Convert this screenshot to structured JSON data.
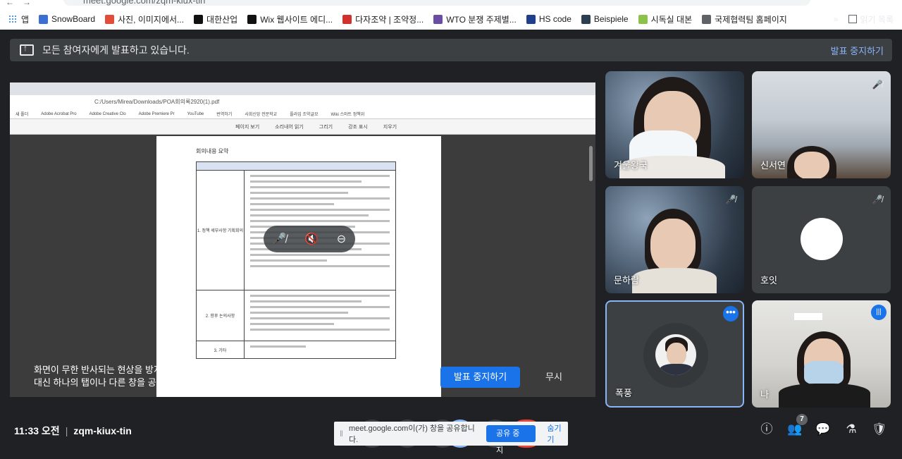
{
  "browser": {
    "url": "meet.google.com/zqm-kiux-tin",
    "bookmarks": [
      {
        "label": "앱",
        "icon": "apps-grid-icon",
        "color": "#1a73e8"
      },
      {
        "label": "SnowBoard",
        "icon": "snowflake-icon",
        "color": "#3b6fd1"
      },
      {
        "label": "사진, 이미지에서...",
        "icon": "image-search-icon",
        "color": "#e34b3b"
      },
      {
        "label": "대한산업",
        "icon": "wix-icon",
        "color": "#111111"
      },
      {
        "label": "Wix 웹사이트 에디...",
        "icon": "wix-icon",
        "color": "#111111"
      },
      {
        "label": "다자조약 | 조약정...",
        "icon": "korea-flag-icon",
        "color": "#d0312d"
      },
      {
        "label": "WTO 분쟁 주제별...",
        "icon": "wto-icon",
        "color": "#6a4ea3"
      },
      {
        "label": "HS code",
        "icon": "shield-icon",
        "color": "#1f3e8c"
      },
      {
        "label": "Beispiele",
        "icon": "dictionary-icon",
        "color": "#2c3e50"
      },
      {
        "label": "시독실 대본",
        "icon": "doc-icon",
        "color": "#8bc34a"
      },
      {
        "label": "국제협력팀 홈페이지",
        "icon": "globe-icon",
        "color": "#5f6368"
      }
    ],
    "overflow": "»",
    "reading_list": "읽기 목록"
  },
  "banner": {
    "message": "모든 참여자에게 발표하고 있습니다.",
    "stop_label": "발표 중지하기"
  },
  "shared_screen": {
    "address": "C:/Users/Mirea/Downloads/POA회의록2920(1).pdf",
    "doc_title": "회의내용 요약",
    "rows": [
      "1. 정책 세부사항 기획회의",
      "2. 향후 논의사항",
      "3. 기타"
    ],
    "bookmarks": [
      "새 폴더",
      "Adobe Acrobat Pro",
      "Adobe Creative Clo",
      "Adobe Premiere Pr",
      "YouTube",
      "번역하기",
      "사회신앙 전문학교",
      "플라임 조약글모",
      "Wiki 스마트 정책위"
    ],
    "toolbar": [
      "페이지 보기",
      "소리내어 읽기",
      "그리기",
      "강조 표시",
      "지우기"
    ]
  },
  "warning": {
    "line1": "화면이 무한 반사되는 현상을 방지하려면 화면이나 브라우저 창의 전체를 공유하지 마세요.",
    "line2": "대신 하나의 탭이나 다른 창을 공유하세요.",
    "stop_label": "발표 중지하기",
    "ignore_label": "무시"
  },
  "participants": [
    {
      "name": "겨울왕국",
      "muted": false
    },
    {
      "name": "신서연",
      "muted": true
    },
    {
      "name": "문하람",
      "muted": true
    },
    {
      "name": "호잇",
      "muted": true
    },
    {
      "name": "폭풍",
      "muted": false,
      "selected": true
    },
    {
      "name": "나",
      "muted": false,
      "speaking": true
    }
  ],
  "bottom": {
    "time": "11:33 오전",
    "meeting_code": "zqm-kiux-tin",
    "people_count": "7",
    "share_notice": "meet.google.com이(가) 창을 공유합니다.",
    "share_stop": "공유 중지",
    "share_hide": "숨기기"
  }
}
